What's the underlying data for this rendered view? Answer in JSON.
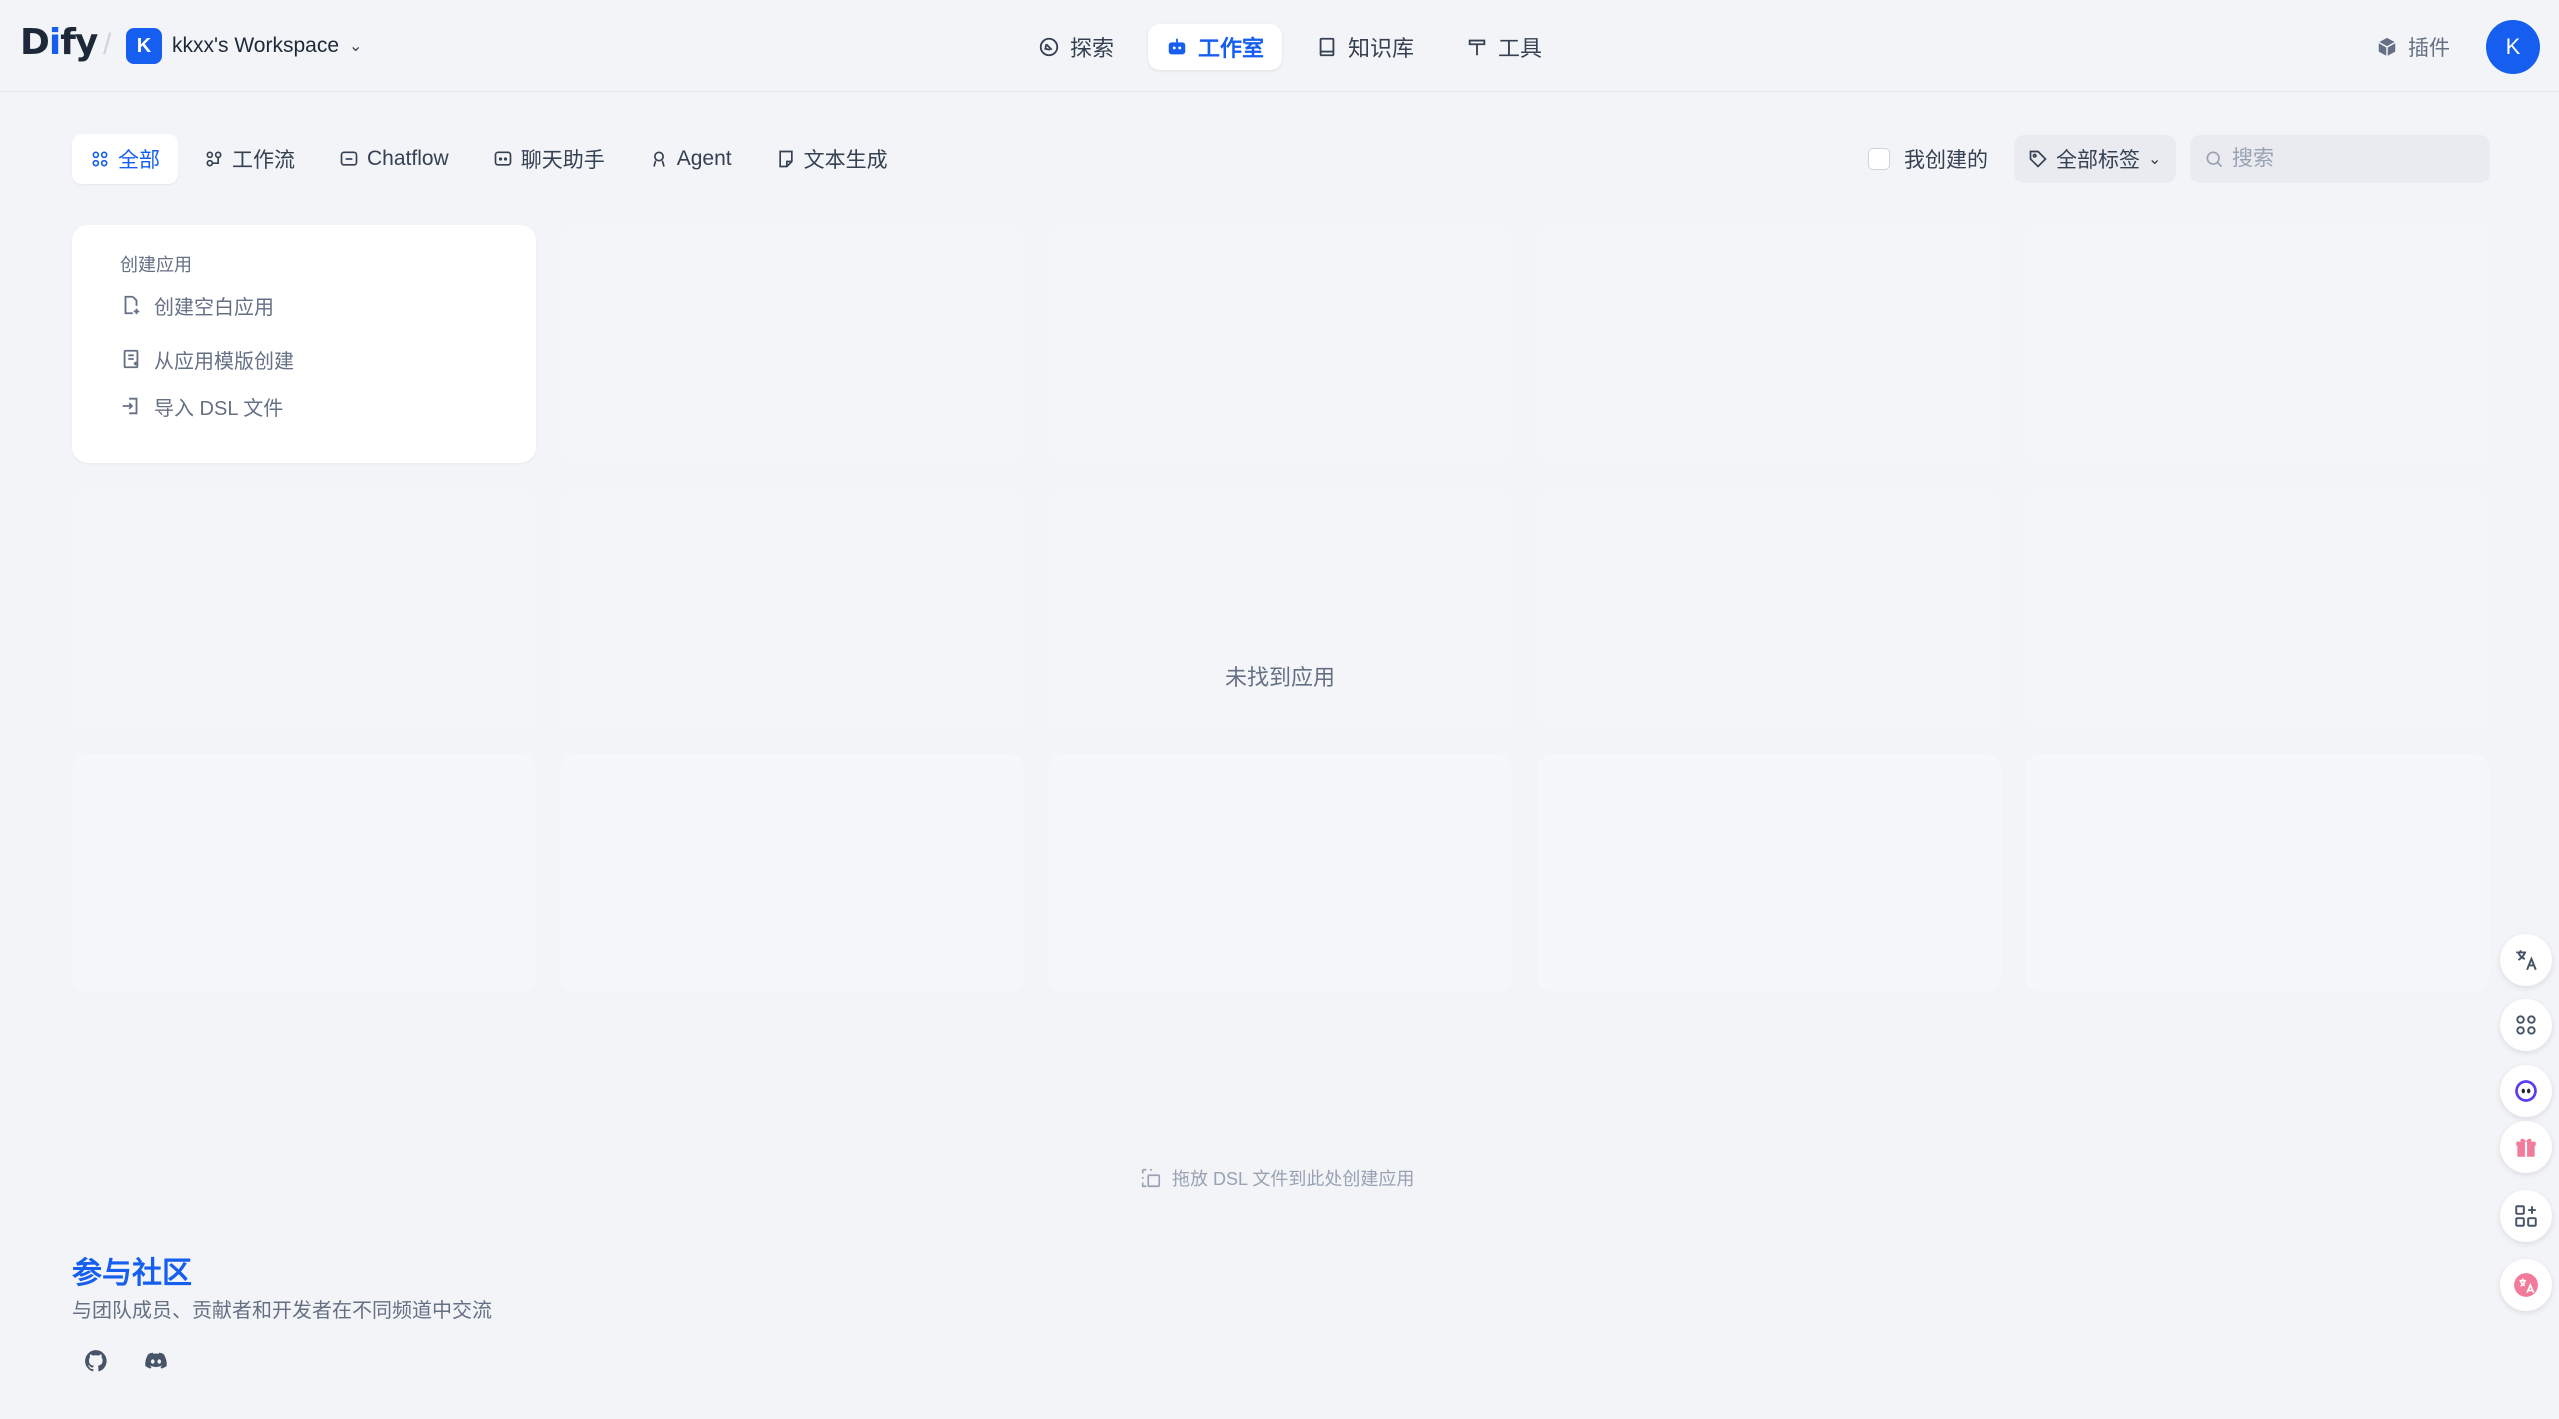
{
  "brand": {
    "logo": "Dify",
    "logo_prefix": "D",
    "logo_dot": "i",
    "logo_suffix": "fy",
    "accent": "#155eef"
  },
  "workspace": {
    "initial": "K",
    "name": "kkxx's Workspace"
  },
  "nav": [
    {
      "label": "探索",
      "icon": "compass-icon"
    },
    {
      "label": "工作室",
      "icon": "robot-icon",
      "active": true
    },
    {
      "label": "知识库",
      "icon": "book-icon"
    },
    {
      "label": "工具",
      "icon": "hammer-icon"
    }
  ],
  "header_right": {
    "plugins_label": "插件",
    "user_initial": "K"
  },
  "filters": [
    {
      "label": "全部",
      "active": true
    },
    {
      "label": "工作流"
    },
    {
      "label": "Chatflow"
    },
    {
      "label": "聊天助手"
    },
    {
      "label": "Agent"
    },
    {
      "label": "文本生成"
    }
  ],
  "toolbar": {
    "mine_label": "我创建的",
    "tags_label": "全部标签",
    "search_placeholder": "搜索",
    "search_value": ""
  },
  "create_card": {
    "title": "创建应用",
    "items": [
      {
        "label": "创建空白应用",
        "icon": "file-plus-icon"
      },
      {
        "label": "从应用模版创建",
        "icon": "template-icon"
      },
      {
        "label": "导入 DSL 文件",
        "icon": "import-icon"
      }
    ]
  },
  "empty_state": "未找到应用",
  "drop_hint": "拖放 DSL 文件到此处创建应用",
  "community": {
    "title": "参与社区",
    "description": "与团队成员、贡献者和开发者在不同频道中交流",
    "links": [
      {
        "icon": "github-icon"
      },
      {
        "icon": "discord-icon"
      }
    ]
  },
  "side_tools": [
    {
      "icon": "translate-icon"
    },
    {
      "icon": "apps-grid-icon"
    },
    {
      "icon": "assistant-face-icon"
    },
    {
      "icon": "gift-icon"
    },
    {
      "icon": "add-widget-icon"
    },
    {
      "icon": "language-switch-icon"
    }
  ]
}
